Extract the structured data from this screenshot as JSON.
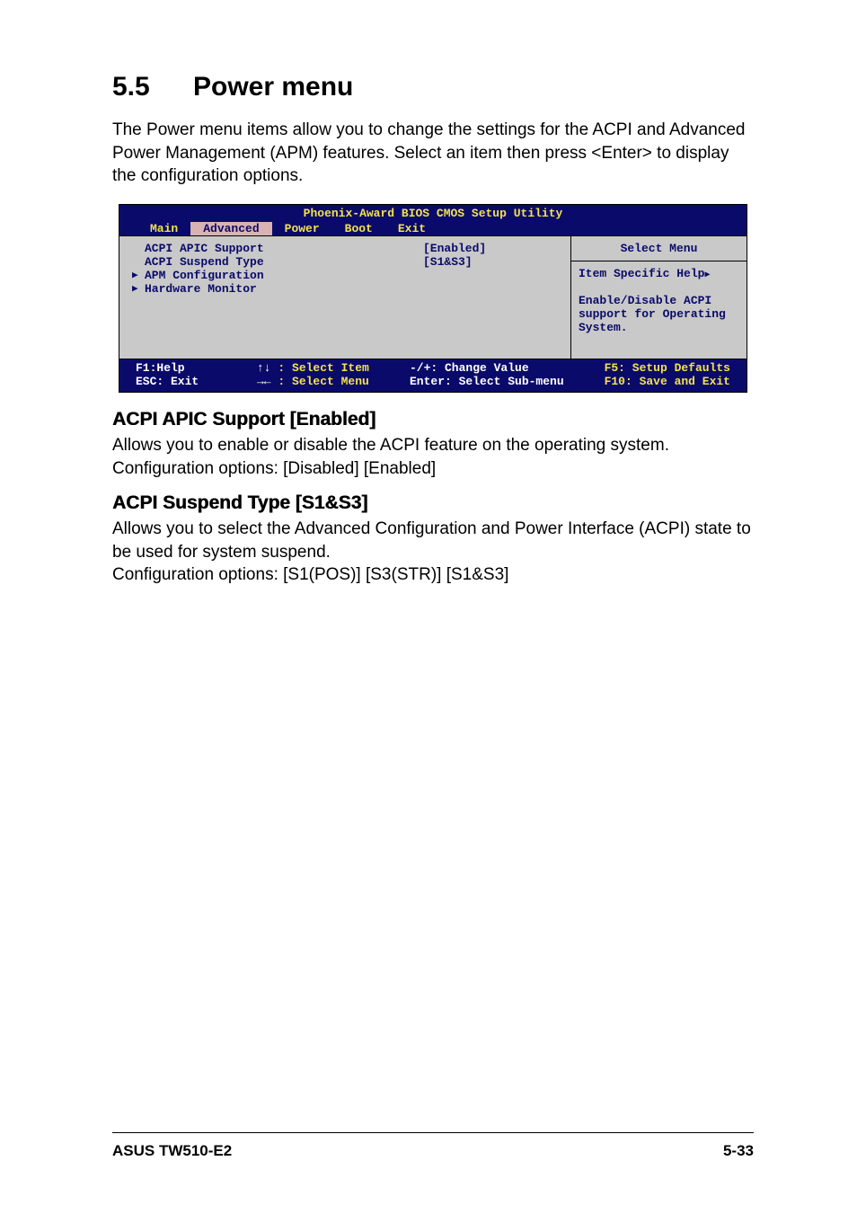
{
  "section": {
    "number": "5.5",
    "title": "Power menu"
  },
  "intro": "The Power menu items allow you to change the settings for the ACPI and Advanced Power Management (APM) features. Select an item then press <Enter> to display the configuration options.",
  "bios": {
    "title": "Phoenix-Award BIOS CMOS Setup Utility",
    "tabs": [
      "Main",
      "Advanced",
      "Power",
      "Boot",
      "Exit"
    ],
    "active_tab": "Advanced",
    "items": [
      {
        "label": "ACPI APIC Support",
        "value": "[Enabled]",
        "submenu": false
      },
      {
        "label": "ACPI Suspend Type",
        "value": "[S1&S3]",
        "submenu": false
      },
      {
        "label": "APM Configuration",
        "value": "",
        "submenu": true
      },
      {
        "label": "Hardware Monitor",
        "value": "",
        "submenu": true
      }
    ],
    "help": {
      "header": "Select Menu",
      "line1": "Item Specific Help",
      "body": "Enable/Disable ACPI support for Operating System."
    },
    "footer": {
      "f1": "F1:Help",
      "esc": "ESC: Exit",
      "sel_item": " : Select Item",
      "sel_menu": " : Select Menu",
      "change": "-/+: Change Value",
      "enter": "Enter: Select Sub-menu",
      "f5": "F5: Setup Defaults",
      "f10": "F10: Save and Exit"
    }
  },
  "sub1": {
    "heading": "ACPI APIC Support [Enabled]",
    "body": "Allows you to enable or disable the ACPI feature on the operating system. Configuration options: [Disabled] [Enabled]"
  },
  "sub2": {
    "heading": "ACPI Suspend Type [S1&S3]",
    "body1": "Allows you to select the Advanced Configuration and Power Interface (ACPI) state to be used for system suspend.",
    "body2": "Configuration options: [S1(POS)] [S3(STR)] [S1&S3]"
  },
  "footer": {
    "left": "ASUS TW510-E2",
    "right": "5-33"
  }
}
